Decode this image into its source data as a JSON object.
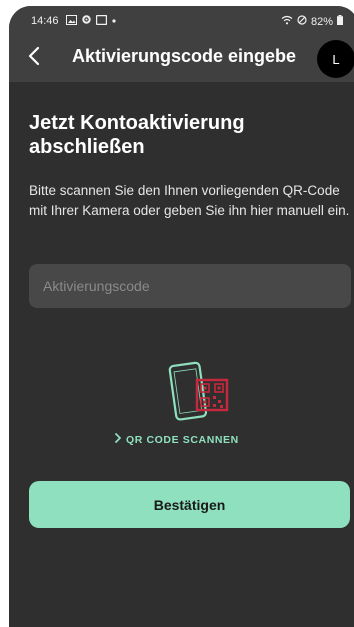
{
  "status_bar": {
    "time": "14:46",
    "battery": "82%",
    "icons": [
      "gallery-icon",
      "settings-icon",
      "screen-icon",
      "dot-icon",
      "wifi-icon",
      "dnd-icon",
      "battery-icon"
    ]
  },
  "app_bar": {
    "back_icon": "chevron-left-icon",
    "title": "Aktivierungscode eingebe",
    "avatar_letter": "L"
  },
  "content": {
    "heading": "Jetzt Kontoaktivierung abschließen",
    "description": "Bitte scannen Sie den Ihnen vorliegenden QR-Code mit Ihrer Kamera oder geben Sie ihn hier manuell ein.",
    "input": {
      "placeholder": "Aktivierungscode",
      "value": ""
    },
    "qr_link_label": "QR CODE SCANNEN",
    "confirm_label": "Bestätigen"
  },
  "colors": {
    "background": "#2f2f2f",
    "app_bar": "#404040",
    "accent": "#8ee0bf",
    "qr_red": "#c8283c"
  }
}
